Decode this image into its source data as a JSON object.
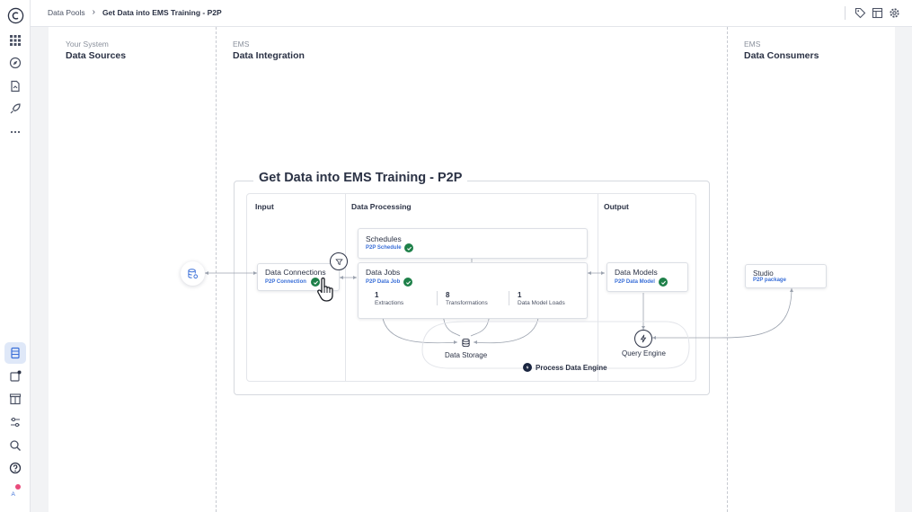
{
  "breadcrumb": {
    "parent": "Data Pools",
    "current": "Get Data into EMS Training - P2P"
  },
  "columns": {
    "sources": {
      "sub": "Your System",
      "title": "Data Sources"
    },
    "integration": {
      "sub": "EMS",
      "title": "Data Integration"
    },
    "consumers": {
      "sub": "EMS",
      "title": "Data Consumers"
    }
  },
  "diagram": {
    "title": "Get Data into EMS Training - P2P",
    "sections": {
      "input": "Input",
      "processing": "Data Processing",
      "output": "Output"
    },
    "data_connections": {
      "title": "Data Connections",
      "link": "P2P Connection"
    },
    "schedules": {
      "title": "Schedules",
      "link": "P2P Schedule"
    },
    "data_jobs": {
      "title": "Data Jobs",
      "link": "P2P Data Job",
      "stats": [
        {
          "num": "1",
          "label": "Extractions"
        },
        {
          "num": "8",
          "label": "Transformations"
        },
        {
          "num": "1",
          "label": "Data Model Loads"
        }
      ]
    },
    "data_models": {
      "title": "Data Models",
      "link": "P2P Data Model"
    },
    "data_storage": "Data Storage",
    "query_engine": "Query Engine",
    "process_data_engine": "Process Data Engine",
    "studio": {
      "title": "Studio",
      "link": "P2P package"
    }
  },
  "colors": {
    "accent": "#3a6fd8",
    "success": "#1e8049",
    "notification": "#e94b7b"
  },
  "icons": {
    "rail": [
      "celonis-logo-icon",
      "apps-grid-icon",
      "compass-icon",
      "document-icon",
      "rocket-icon",
      "more-icon",
      "data-integration-icon",
      "notification-icon",
      "package-icon",
      "sliders-icon",
      "search-icon",
      "help-icon",
      "user-avatar-icon"
    ],
    "top": [
      "tag-icon",
      "layout-icon",
      "settings-icon"
    ]
  }
}
